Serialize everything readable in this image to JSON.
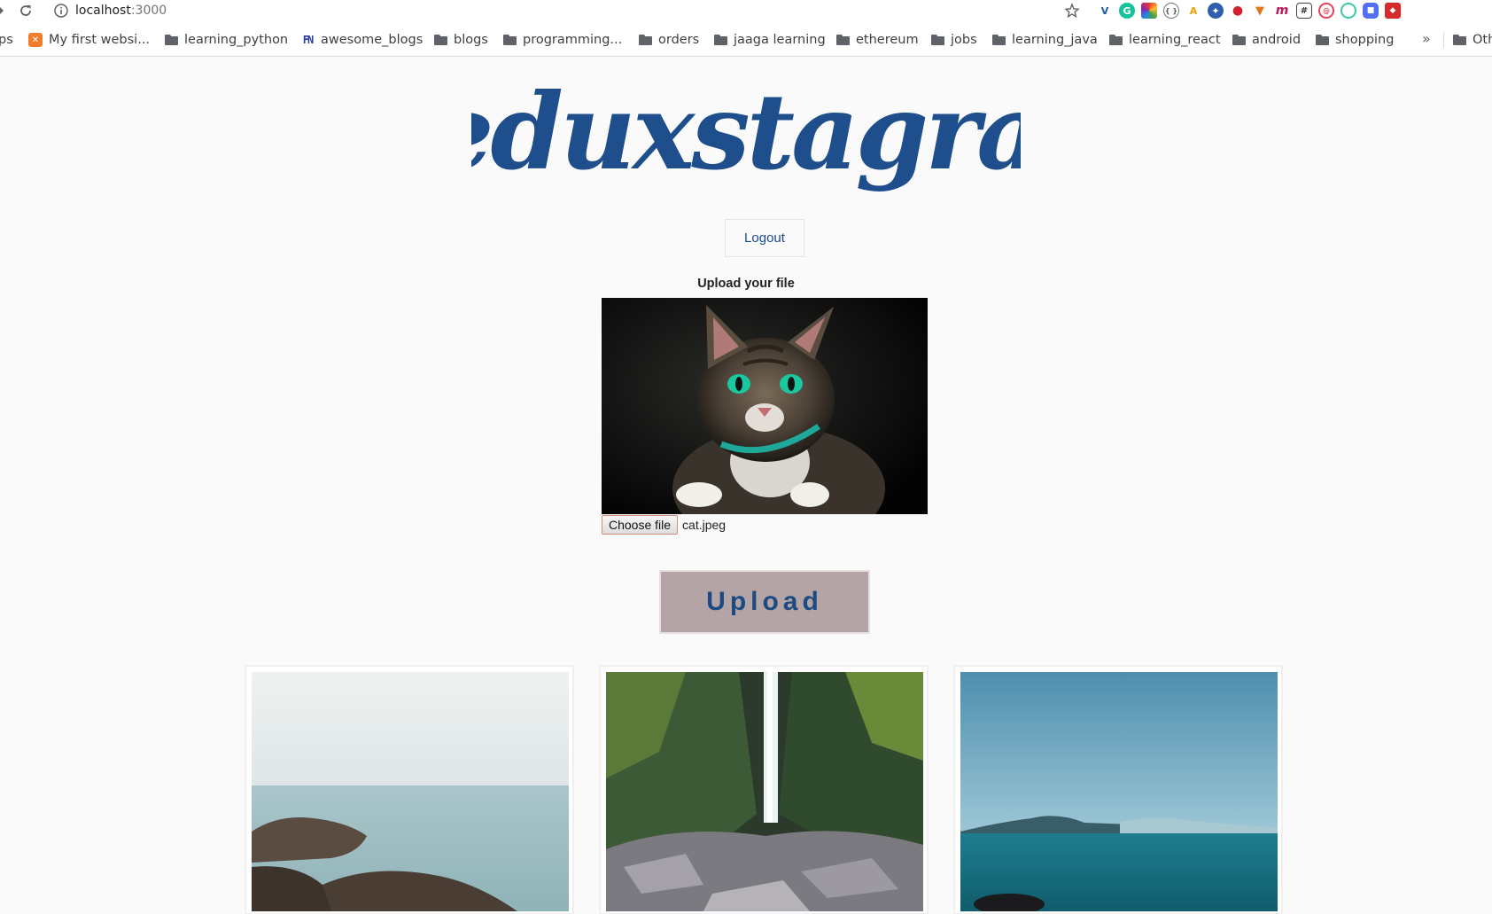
{
  "browser": {
    "url_host": "localhost",
    "url_port": ":3000",
    "bookmarks": [
      {
        "label": "ps",
        "icon": "none"
      },
      {
        "label": "My first websi...",
        "icon": "xampp-icon"
      },
      {
        "label": "learning_python",
        "icon": "folder-icon"
      },
      {
        "label": "awesome_blogs",
        "icon": "fn-icon"
      },
      {
        "label": "blogs",
        "icon": "folder-icon"
      },
      {
        "label": "programming...",
        "icon": "folder-icon"
      },
      {
        "label": "orders",
        "icon": "folder-icon"
      },
      {
        "label": "jaaga learning",
        "icon": "folder-icon"
      },
      {
        "label": "ethereum",
        "icon": "folder-icon"
      },
      {
        "label": "jobs",
        "icon": "folder-icon"
      },
      {
        "label": "learning_java",
        "icon": "folder-icon"
      },
      {
        "label": "learning_react",
        "icon": "folder-icon"
      },
      {
        "label": "android",
        "icon": "folder-icon"
      },
      {
        "label": "shopping",
        "icon": "folder-icon"
      },
      {
        "label": "Oth",
        "icon": "folder-icon"
      }
    ],
    "overflow_label": "»"
  },
  "app": {
    "title": "Reduxstagram",
    "brand_color": "#1f4e8c",
    "logout_label": "Logout",
    "upload_prompt": "Upload your file",
    "choose_file_label": "Choose file",
    "chosen_file_name": "cat.jpeg",
    "upload_button_label": "Upload",
    "upload_button_color": "#b5a4a6"
  },
  "gallery": [
    {
      "subject": "rocky shoreline with calm sea"
    },
    {
      "subject": "waterfall in mossy canyon"
    },
    {
      "subject": "open sea with distant island"
    }
  ]
}
